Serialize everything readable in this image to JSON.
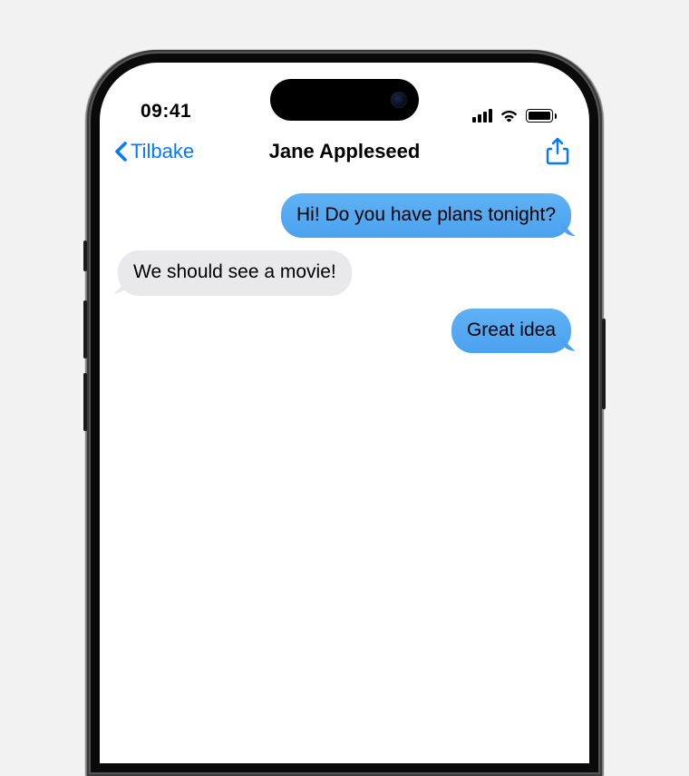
{
  "status": {
    "time": "09:41"
  },
  "nav": {
    "back_label": "Tilbake",
    "title": "Jane Appleseed"
  },
  "messages": [
    {
      "direction": "sent",
      "text": "Hi! Do you have plans tonight?"
    },
    {
      "direction": "received",
      "text": "We should see a movie!"
    },
    {
      "direction": "sent",
      "text": "Great idea"
    }
  ],
  "colors": {
    "accent": "#007aff",
    "sent_bubble": "#4aa2f0",
    "received_bubble": "#e9e9eb"
  }
}
